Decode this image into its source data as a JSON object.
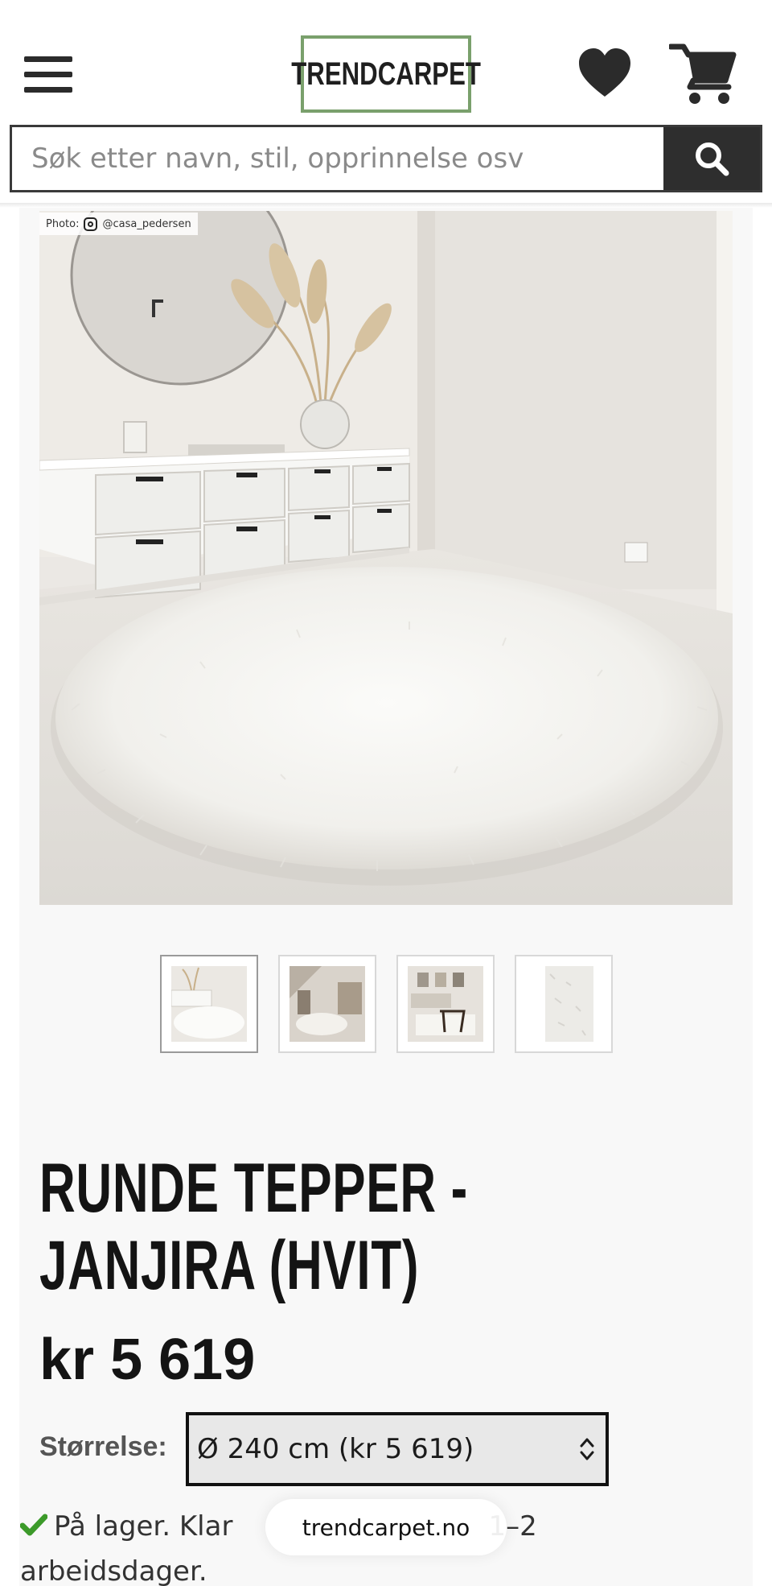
{
  "header": {
    "logo_text": "TRENDCARPET",
    "menu_icon": "hamburger-menu-icon",
    "wishlist_icon": "heart-icon",
    "cart_icon": "shopping-cart-icon"
  },
  "search": {
    "placeholder": "Søk etter navn, stil, opprinnelse osv",
    "value": "",
    "button_icon": "search-icon"
  },
  "gallery": {
    "photo_credit": "Photo:",
    "photo_credit_handle": "@casa_pedersen",
    "thumbnails": [
      {
        "alt": "Round white shaggy rug in hallway",
        "active": true
      },
      {
        "alt": "Round white rug under stairs",
        "active": false
      },
      {
        "alt": "White rug in living room",
        "active": false
      },
      {
        "alt": "White rug close-up",
        "active": false
      }
    ]
  },
  "product": {
    "title": "RUNDE TEPPER - JANJIRA (HVIT)",
    "price": "kr 5 619",
    "size_label": "Størrelse:",
    "size_selected": "Ø 240 cm (kr 5 619)",
    "stock_text": "På lager. Klar til forsendelse innen 1–2 arbeidsdager.",
    "stock_visible_1": "På lager. Klar",
    "stock_visible_2": "1–2",
    "stock_visible_3": "arbeidsdager."
  },
  "browser": {
    "url": "trendcarpet.no"
  },
  "colors": {
    "logo_border": "#7aa06c",
    "search_button": "#2e2e2e",
    "stock_check": "#3c9a2a"
  }
}
